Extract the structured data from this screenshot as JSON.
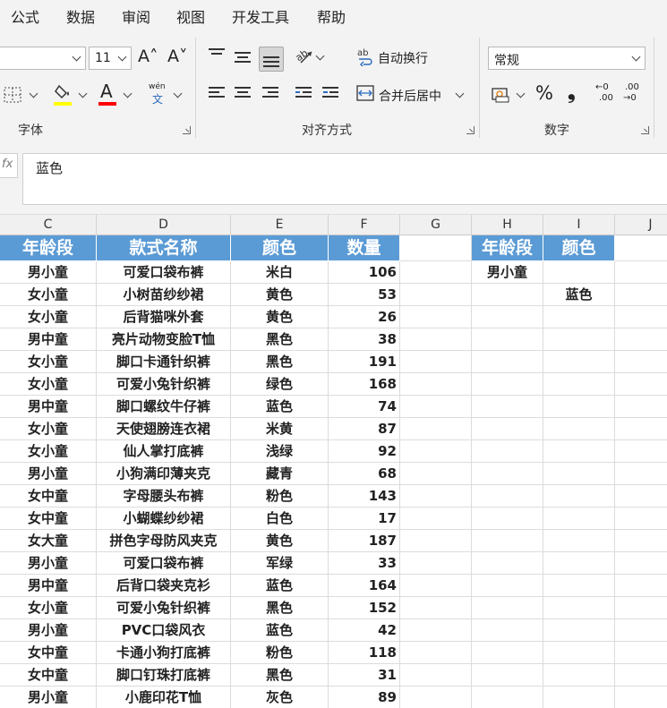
{
  "menu": [
    "公式",
    "数据",
    "审阅",
    "视图",
    "开发工具",
    "帮助"
  ],
  "ribbon": {
    "font_size": "11",
    "font_group_label": "字体",
    "align_group_label": "对齐方式",
    "number_group_label": "数字",
    "wrap_text_label": "自动换行",
    "merge_center_label": "合并后居中",
    "number_format": "常规",
    "phonetic_label": "wén",
    "phonetic_char": "文",
    "percent_symbol": "%",
    "comma_symbol": "❟",
    "dec_inc_top": "←0",
    "dec_inc_bottom": ".00",
    "dec_dec_top": ".00",
    "dec_dec_bottom": "→0",
    "font_color_letter": "A",
    "grow_font": "A˄",
    "shrink_font": "A˅",
    "colors": {
      "highlight": "#ffff00",
      "font_color": "#ff0000",
      "header_fill": "#5b9bd5"
    }
  },
  "formula_bar": {
    "fx_label": "fx",
    "content": "蓝色"
  },
  "columns": [
    "C",
    "D",
    "E",
    "F",
    "G",
    "H",
    "I",
    "J"
  ],
  "table": {
    "headers": [
      "年龄段",
      "款式名称",
      "颜色",
      "数量"
    ],
    "rows": [
      [
        "男小童",
        "可爱口袋布裤",
        "米白",
        "106"
      ],
      [
        "女小童",
        "小树苗纱纱裙",
        "黄色",
        "53"
      ],
      [
        "女小童",
        "后背猫咪外套",
        "黄色",
        "26"
      ],
      [
        "男中童",
        "亮片动物变脸T恤",
        "黑色",
        "38"
      ],
      [
        "女小童",
        "脚口卡通针织裤",
        "黑色",
        "191"
      ],
      [
        "女小童",
        "可爱小兔针织裤",
        "绿色",
        "168"
      ],
      [
        "男中童",
        "脚口螺纹牛仔裤",
        "蓝色",
        "74"
      ],
      [
        "女小童",
        "天使翅膀连衣裙",
        "米黄",
        "87"
      ],
      [
        "女小童",
        "仙人掌打底裤",
        "浅绿",
        "92"
      ],
      [
        "男小童",
        "小狗满印薄夹克",
        "藏青",
        "68"
      ],
      [
        "女中童",
        "字母腰头布裤",
        "粉色",
        "143"
      ],
      [
        "女中童",
        "小蝴蝶纱纱裙",
        "白色",
        "17"
      ],
      [
        "女大童",
        "拼色字母防风夹克",
        "黄色",
        "187"
      ],
      [
        "男小童",
        "可爱口袋布裤",
        "军绿",
        "33"
      ],
      [
        "男中童",
        "后背口袋夹克衫",
        "蓝色",
        "164"
      ],
      [
        "女小童",
        "可爱小兔针织裤",
        "黑色",
        "152"
      ],
      [
        "男小童",
        "PVC口袋风衣",
        "蓝色",
        "42"
      ],
      [
        "女中童",
        "卡通小狗打底裤",
        "粉色",
        "118"
      ],
      [
        "女中童",
        "脚口钉珠打底裤",
        "黑色",
        "31"
      ],
      [
        "男小童",
        "小鹿印花T恤",
        "灰色",
        "89"
      ]
    ]
  },
  "criteria": {
    "headers": [
      "年龄段",
      "颜色"
    ],
    "age_value": "男小童",
    "color_value": "蓝色"
  }
}
